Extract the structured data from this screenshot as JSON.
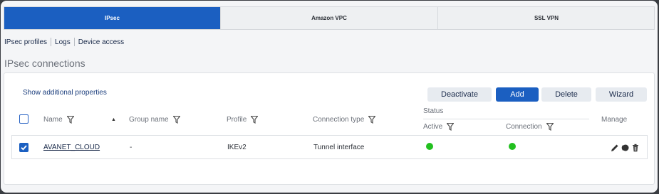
{
  "tabs": [
    {
      "label": "IPsec",
      "active": true
    },
    {
      "label": "Amazon VPC",
      "active": false
    },
    {
      "label": "SSL VPN",
      "active": false
    }
  ],
  "subnav": [
    "IPsec profiles",
    "Logs",
    "Device access"
  ],
  "section_title": "IPsec connections",
  "show_props": "Show additional properties",
  "buttons": {
    "deactivate": "Deactivate",
    "add": "Add",
    "delete": "Delete",
    "wizard": "Wizard"
  },
  "columns": {
    "name": "Name",
    "group": "Group name",
    "profile": "Profile",
    "type": "Connection type",
    "status": "Status",
    "active": "Active",
    "connection": "Connection",
    "manage": "Manage"
  },
  "rows": [
    {
      "name": "AVANET_CLOUD",
      "group": "-",
      "profile": "IKEv2",
      "type": "Tunnel interface",
      "selected": true,
      "active_status": "green",
      "connection_status": "green"
    }
  ],
  "colors": {
    "accent": "#1b5fc1",
    "status_ok": "#22c01f"
  }
}
